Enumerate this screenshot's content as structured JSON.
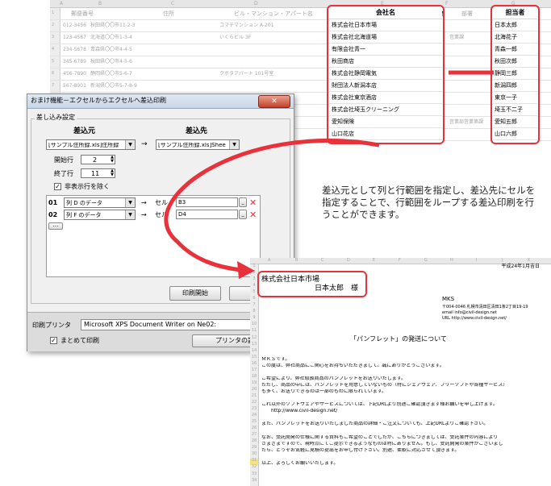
{
  "top_sheet": {
    "col_headers": [
      "A",
      "B",
      "C",
      "D",
      "E",
      "F",
      "G"
    ],
    "col_labels": [
      "郵便番号",
      "住所",
      "ビル・マンション・アパート名",
      "会社名",
      "部署",
      "担当者"
    ],
    "row_numbers": [
      "1",
      "2",
      "3",
      "4",
      "5",
      "6",
      "7",
      "8",
      "9",
      "10",
      "11"
    ],
    "postal_codes": [
      "012-3456",
      "123-4567",
      "234-5678",
      "345-6789",
      "456-7890",
      "567-8901"
    ],
    "addresses": [
      "秋田県〇〇市11-2-3",
      "北海道〇〇市1-3-4",
      "青森県〇〇市4-4-5",
      "秋田県〇〇市4-5-6",
      "静岡県〇〇市5-6-7",
      "新潟県〇〇市5-7-8-9"
    ],
    "buildings": [
      "コマチマンション A-201",
      "いくらビル 3F",
      "",
      "",
      "クボタアパート 101号室",
      ""
    ],
    "companies": [
      "株式会社日本市場",
      "株式会社北海道場",
      "有限会社青一",
      "秋田商店",
      "株式会社静岡電気",
      "財団法人新潟本店",
      "株式会社東京酒店",
      "株式会社埼玉クリーニング",
      "愛知保険",
      "山口花店"
    ],
    "departments": [
      "",
      "営業課",
      "",
      "",
      "",
      "",
      "",
      "",
      "営業部営業第課",
      ""
    ],
    "persons": [
      "日本太郎",
      "北海花子",
      "青森一郎",
      "秋田次郎",
      "静岡三郎",
      "新潟四郎",
      "東京一子",
      "埼玉不二子",
      "愛知五郎",
      "山口六郎"
    ]
  },
  "dialog": {
    "title": "おまけ機能－エクセルからエクセルへ差込印刷",
    "close_label": "✕",
    "group_label": "差し込み設定",
    "source_label": "差込元",
    "dest_label": "差込先",
    "source_value": "[サンプル住所録.xls]住所録",
    "dest_value": "[サンプル住所録.xls]Shee",
    "arrow": "→",
    "start_row_label": "開始行",
    "start_row_value": "2",
    "end_row_label": "終了行",
    "end_row_value": "11",
    "hidden_rows_label": "非表示行を除く",
    "mappings": [
      {
        "num": "01",
        "column": "列 D のデータ",
        "cell_label": "セル",
        "cell": "B3"
      },
      {
        "num": "02",
        "column": "列 F のデータ",
        "cell_label": "セル",
        "cell": "D4"
      }
    ],
    "more_label": "…",
    "print_start_label": "印刷開始",
    "close_button_label": "閉",
    "printer_label": "印刷プリンタ",
    "printer_value": "Microsoft XPS Document Writer on Ne02:",
    "batch_print_label": "まとめて印刷",
    "printer_settings_label": "プリンタの設定と"
  },
  "caption": "差込元として列と行範囲を指定し、差込先にセルを指定することで、行範囲をループする差込印刷を行うことができます。",
  "bottom_sheet": {
    "col_headers": [
      "A",
      "B",
      "C",
      "D",
      "E",
      "F",
      "G",
      "H",
      "I",
      "J",
      "K"
    ],
    "row_numbers": [
      "1",
      "2",
      "3",
      "4",
      "5",
      "6",
      "7",
      "8",
      "9",
      "10",
      "11",
      "12",
      "13",
      "14",
      "15",
      "16",
      "17",
      "18",
      "19",
      "20",
      "21",
      "22",
      "23",
      "24",
      "25",
      "26",
      "27",
      "28",
      "29",
      "30",
      "31",
      "32",
      "33",
      "34"
    ],
    "date": "平成24年1月吉日",
    "company": "株式会社日本市場",
    "person": "日本太郎　様",
    "sender": "MKS",
    "sender_addr1": "〒004-0046 札幌市清田区清田1条2丁目19-19",
    "sender_addr2": "email info@civil-design.net",
    "sender_addr3": "URL http://www.civil-design.net/",
    "subject": "「パンフレット」の発送について",
    "body": [
      "ＭＫＳです。",
      "この度は、弊社商品にご関心をお持ちいただきまして、誠にありがとうございます。",
      "",
      "ご希望により、弊社取扱商品のパンフレットをお送りいたします。",
      "ただし、商品の中には、パンフレットを用意していないもの（特にシェアウェア、フリーソフトや各種サービス）",
      "も多く、お送りできるのは一部のものに限られています。",
      "",
      "これ以外のソフトウェアやサービスについては、下記URLより別途ご確認頂きます様お願いを申し上げます。",
      "　　http://www.civil-design.net/",
      "",
      "また、パンフレットをお送りいたしました商品の詳細・ご注文についても、上記URLよりご確認下さい。",
      "",
      "なお、受託開発の仕様に関する資料もご希望のことでしたが、こちらにつきましては、受託案件の内容により",
      "さまざまですので、現時点にてご提示できるようなものは特にありません。もし、受託開発の案件がございまし",
      "たら、どうぞお気軽に見積の提出をお申し付け下さい。別途、柔軟に対応させて頂きます。",
      "",
      "以上、よろしくお願いいたします。"
    ]
  }
}
